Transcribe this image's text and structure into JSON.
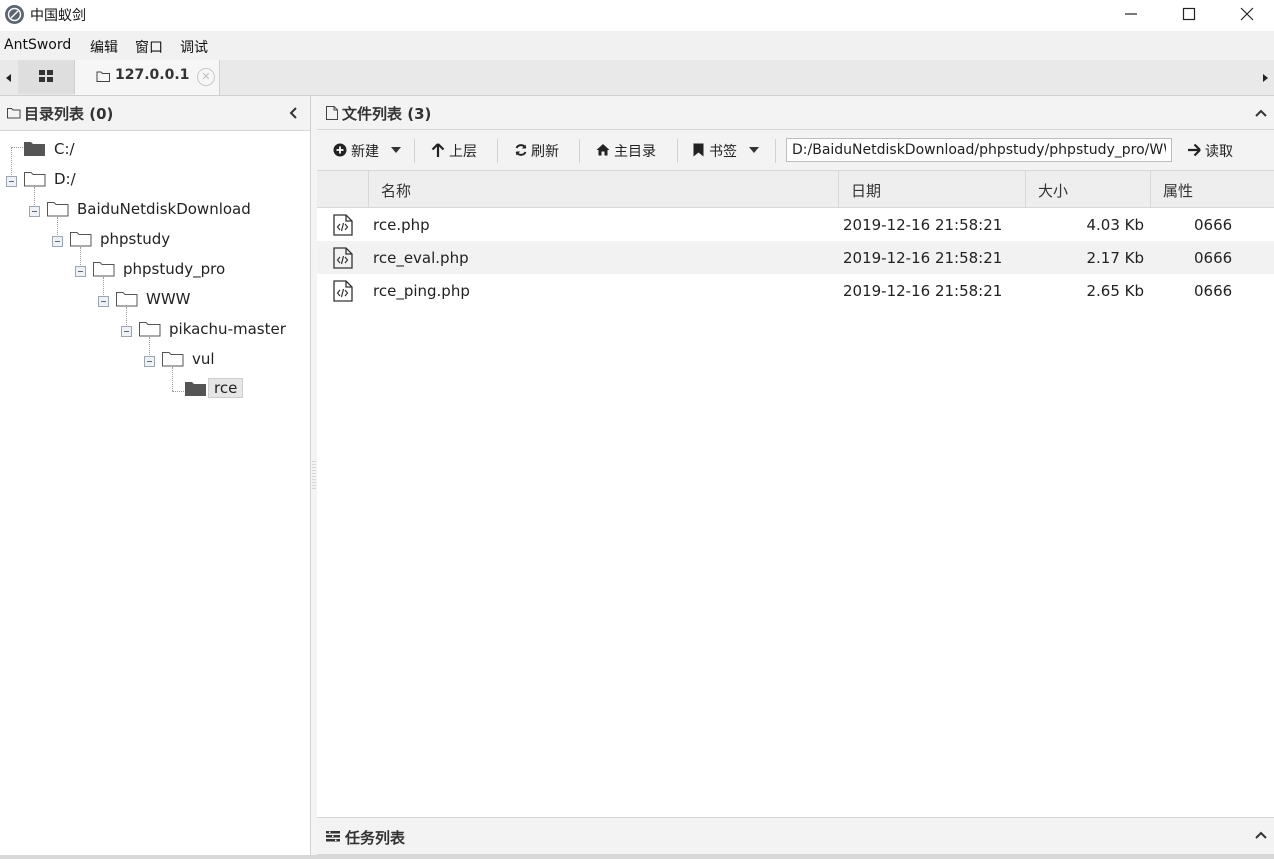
{
  "window": {
    "title": "中国蚁剑"
  },
  "menu": {
    "items": [
      "AntSword",
      "编辑",
      "窗口",
      "调试"
    ]
  },
  "tabs": {
    "site_label": "127.0.0.1"
  },
  "dir_panel": {
    "title": "目录列表 (0)",
    "tree": [
      {
        "label": "C:/",
        "icon": "folder-filled-icon"
      },
      {
        "label": "D:/",
        "icon": "folder-open-icon"
      },
      {
        "label": "BaiduNetdiskDownload",
        "icon": "folder-open-icon"
      },
      {
        "label": "phpstudy",
        "icon": "folder-open-icon"
      },
      {
        "label": "phpstudy_pro",
        "icon": "folder-open-icon"
      },
      {
        "label": "WWW",
        "icon": "folder-open-icon"
      },
      {
        "label": "pikachu-master",
        "icon": "folder-open-icon"
      },
      {
        "label": "vul",
        "icon": "folder-open-icon"
      },
      {
        "label": "rce",
        "icon": "folder-filled-icon",
        "selected": true
      }
    ]
  },
  "file_panel": {
    "title": "文件列表 (3)",
    "toolbar": {
      "new_label": "新建",
      "up_label": "上层",
      "refresh_label": "刷新",
      "home_label": "主目录",
      "bookmark_label": "书签",
      "path_value": "D:/BaiduNetdiskDownload/phpstudy/phpstudy_pro/WWW",
      "read_label": "读取"
    },
    "columns": {
      "name": "名称",
      "date": "日期",
      "size": "大小",
      "attr": "属性"
    },
    "rows": [
      {
        "name": "rce.php",
        "date": "2019-12-16 21:58:21",
        "size": "4.03 Kb",
        "attr": "0666"
      },
      {
        "name": "rce_eval.php",
        "date": "2019-12-16 21:58:21",
        "size": "2.17 Kb",
        "attr": "0666"
      },
      {
        "name": "rce_ping.php",
        "date": "2019-12-16 21:58:21",
        "size": "2.65 Kb",
        "attr": "0666"
      }
    ]
  },
  "task_panel": {
    "title": "任务列表"
  },
  "colors": {
    "header_bg": "#f3f3f3",
    "row_alt_bg": "#f2f2f2",
    "border": "#d6d6d6"
  }
}
